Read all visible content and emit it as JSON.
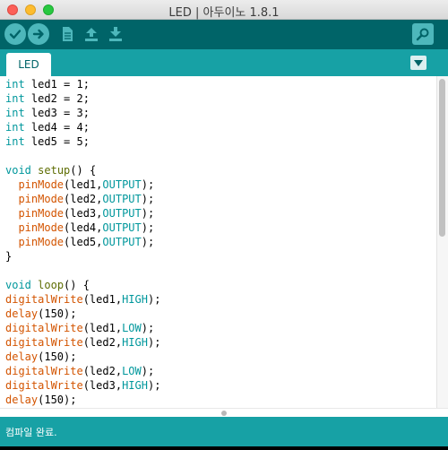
{
  "window": {
    "title": "LED | 아두이노 1.8.1"
  },
  "toolbar": {
    "buttons": [
      {
        "name": "verify",
        "icon": "checkmark-icon"
      },
      {
        "name": "upload",
        "icon": "arrow-right-icon"
      },
      {
        "name": "new",
        "icon": "document-icon"
      },
      {
        "name": "open",
        "icon": "arrow-up-icon"
      },
      {
        "name": "save",
        "icon": "arrow-down-icon"
      },
      {
        "name": "serial-monitor",
        "icon": "magnifier-icon"
      }
    ]
  },
  "tabs": [
    {
      "label": "LED",
      "active": true
    }
  ],
  "editor": {
    "lines": [
      [
        {
          "t": "int",
          "c": "type"
        },
        {
          "t": " led1 = 1;",
          "c": ""
        }
      ],
      [
        {
          "t": "int",
          "c": "type"
        },
        {
          "t": " led2 = 2;",
          "c": ""
        }
      ],
      [
        {
          "t": "int",
          "c": "type"
        },
        {
          "t": " led3 = 3;",
          "c": ""
        }
      ],
      [
        {
          "t": "int",
          "c": "type"
        },
        {
          "t": " led4 = 4;",
          "c": ""
        }
      ],
      [
        {
          "t": "int",
          "c": "type"
        },
        {
          "t": " led5 = 5;",
          "c": ""
        }
      ],
      [],
      [
        {
          "t": "void",
          "c": "type"
        },
        {
          "t": " ",
          "c": ""
        },
        {
          "t": "setup",
          "c": "struct"
        },
        {
          "t": "() {",
          "c": ""
        }
      ],
      [
        {
          "t": "  ",
          "c": ""
        },
        {
          "t": "pinMode",
          "c": "fn"
        },
        {
          "t": "(led1,",
          "c": ""
        },
        {
          "t": "OUTPUT",
          "c": "const"
        },
        {
          "t": ");",
          "c": ""
        }
      ],
      [
        {
          "t": "  ",
          "c": ""
        },
        {
          "t": "pinMode",
          "c": "fn"
        },
        {
          "t": "(led2,",
          "c": ""
        },
        {
          "t": "OUTPUT",
          "c": "const"
        },
        {
          "t": ");",
          "c": ""
        }
      ],
      [
        {
          "t": "  ",
          "c": ""
        },
        {
          "t": "pinMode",
          "c": "fn"
        },
        {
          "t": "(led3,",
          "c": ""
        },
        {
          "t": "OUTPUT",
          "c": "const"
        },
        {
          "t": ");",
          "c": ""
        }
      ],
      [
        {
          "t": "  ",
          "c": ""
        },
        {
          "t": "pinMode",
          "c": "fn"
        },
        {
          "t": "(led4,",
          "c": ""
        },
        {
          "t": "OUTPUT",
          "c": "const"
        },
        {
          "t": ");",
          "c": ""
        }
      ],
      [
        {
          "t": "  ",
          "c": ""
        },
        {
          "t": "pinMode",
          "c": "fn"
        },
        {
          "t": "(led5,",
          "c": ""
        },
        {
          "t": "OUTPUT",
          "c": "const"
        },
        {
          "t": ");",
          "c": ""
        }
      ],
      [
        {
          "t": "}",
          "c": ""
        }
      ],
      [],
      [
        {
          "t": "void",
          "c": "type"
        },
        {
          "t": " ",
          "c": ""
        },
        {
          "t": "loop",
          "c": "struct"
        },
        {
          "t": "() {",
          "c": ""
        }
      ],
      [
        {
          "t": "digitalWrite",
          "c": "fn"
        },
        {
          "t": "(led1,",
          "c": ""
        },
        {
          "t": "HIGH",
          "c": "const"
        },
        {
          "t": ");",
          "c": ""
        }
      ],
      [
        {
          "t": "delay",
          "c": "fn"
        },
        {
          "t": "(150);",
          "c": ""
        }
      ],
      [
        {
          "t": "digitalWrite",
          "c": "fn"
        },
        {
          "t": "(led1,",
          "c": ""
        },
        {
          "t": "LOW",
          "c": "const"
        },
        {
          "t": ");",
          "c": ""
        }
      ],
      [
        {
          "t": "digitalWrite",
          "c": "fn"
        },
        {
          "t": "(led2,",
          "c": ""
        },
        {
          "t": "HIGH",
          "c": "const"
        },
        {
          "t": ");",
          "c": ""
        }
      ],
      [
        {
          "t": "delay",
          "c": "fn"
        },
        {
          "t": "(150);",
          "c": ""
        }
      ],
      [
        {
          "t": "digitalWrite",
          "c": "fn"
        },
        {
          "t": "(led2,",
          "c": ""
        },
        {
          "t": "LOW",
          "c": "const"
        },
        {
          "t": ");",
          "c": ""
        }
      ],
      [
        {
          "t": "digitalWrite",
          "c": "fn"
        },
        {
          "t": "(led3,",
          "c": ""
        },
        {
          "t": "HIGH",
          "c": "const"
        },
        {
          "t": ");",
          "c": ""
        }
      ],
      [
        {
          "t": "delay",
          "c": "fn"
        },
        {
          "t": "(150);",
          "c": ""
        }
      ]
    ]
  },
  "status": {
    "message": "컴파일 완료."
  },
  "colors": {
    "toolbar": "#006468",
    "tabbar": "#17a1a5",
    "button": "#4db7bb",
    "keyword_type": "#00979c",
    "keyword_function": "#d35400",
    "keyword_struct": "#5e6d03"
  }
}
